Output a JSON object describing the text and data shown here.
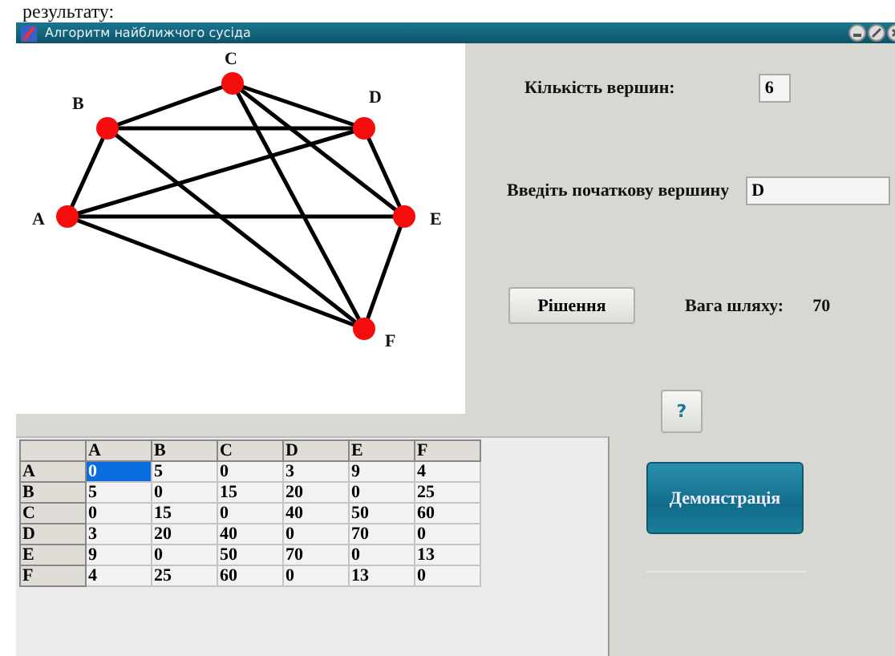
{
  "doc_text": "результату:",
  "window": {
    "title": "Алгоритм найближчого сусіда"
  },
  "graph": {
    "nodes": [
      {
        "label": "A"
      },
      {
        "label": "B"
      },
      {
        "label": "C"
      },
      {
        "label": "D"
      },
      {
        "label": "E"
      },
      {
        "label": "F"
      }
    ]
  },
  "vertex_count": {
    "label": "Кількість вершин:",
    "value": "6"
  },
  "start_vertex": {
    "label": "Введіть початкову вершину",
    "value": "D"
  },
  "solve_button": "Рішення",
  "path_weight": {
    "label": "Вага шляху:",
    "value": "70"
  },
  "help_button": "?",
  "demo_button": "Демонстрація",
  "table": {
    "columns": [
      "A",
      "B",
      "C",
      "D",
      "E",
      "F"
    ],
    "rows": [
      {
        "header": "A",
        "cells": [
          {
            "value": "0",
            "selected": true
          },
          {
            "value": "5",
            "selected": false
          },
          {
            "value": "0",
            "selected": false
          },
          {
            "value": "3",
            "selected": false
          },
          {
            "value": "9",
            "selected": false
          },
          {
            "value": "4",
            "selected": false
          }
        ]
      },
      {
        "header": "B",
        "cells": [
          {
            "value": "5",
            "selected": false
          },
          {
            "value": "0",
            "selected": false
          },
          {
            "value": "15",
            "selected": false
          },
          {
            "value": "20",
            "selected": false
          },
          {
            "value": "0",
            "selected": false
          },
          {
            "value": "25",
            "selected": false
          }
        ]
      },
      {
        "header": "C",
        "cells": [
          {
            "value": "0",
            "selected": false
          },
          {
            "value": "15",
            "selected": false
          },
          {
            "value": "0",
            "selected": false
          },
          {
            "value": "40",
            "selected": false
          },
          {
            "value": "50",
            "selected": false
          },
          {
            "value": "60",
            "selected": false
          }
        ]
      },
      {
        "header": "D",
        "cells": [
          {
            "value": "3",
            "selected": false
          },
          {
            "value": "20",
            "selected": false
          },
          {
            "value": "40",
            "selected": false
          },
          {
            "value": "0",
            "selected": false
          },
          {
            "value": "70",
            "selected": false
          },
          {
            "value": "0",
            "selected": false
          }
        ]
      },
      {
        "header": "E",
        "cells": [
          {
            "value": "9",
            "selected": false
          },
          {
            "value": "0",
            "selected": false
          },
          {
            "value": "50",
            "selected": false
          },
          {
            "value": "70",
            "selected": false
          },
          {
            "value": "0",
            "selected": false
          },
          {
            "value": "13",
            "selected": false
          }
        ]
      },
      {
        "header": "F",
        "cells": [
          {
            "value": "4",
            "selected": false
          },
          {
            "value": "25",
            "selected": false
          },
          {
            "value": "60",
            "selected": false
          },
          {
            "value": "0",
            "selected": false
          },
          {
            "value": "13",
            "selected": false
          },
          {
            "value": "0",
            "selected": false
          }
        ]
      }
    ]
  }
}
